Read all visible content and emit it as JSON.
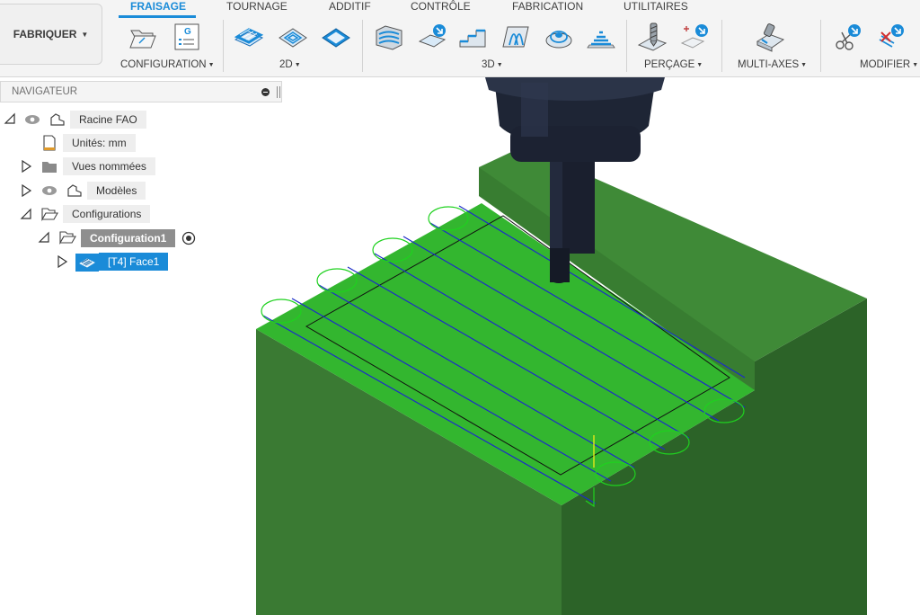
{
  "workspace": {
    "label": "FABRIQUER"
  },
  "tabs": [
    {
      "label": "FRAISAGE",
      "active": true
    },
    {
      "label": "TOURNAGE"
    },
    {
      "label": "ADDITIF"
    },
    {
      "label": "CONTRÔLE"
    },
    {
      "label": "FABRICATION"
    },
    {
      "label": "UTILITAIRES"
    }
  ],
  "groups": {
    "configuration": {
      "label": "CONFIGURATION"
    },
    "g2d": {
      "label": "2D"
    },
    "g3d": {
      "label": "3D"
    },
    "percage": {
      "label": "PERÇAGE"
    },
    "multiaxes": {
      "label": "MULTI-AXES"
    },
    "modifier": {
      "label": "MODIFIER"
    }
  },
  "tools": {
    "new_setup_icon": "folder-open-icon",
    "nc_program_label": "G"
  },
  "navigator": {
    "title": "NAVIGATEUR",
    "items": [
      {
        "label": "Racine FAO"
      },
      {
        "label": "Unités: mm"
      },
      {
        "label": "Vues nommées"
      },
      {
        "label": "Modèles"
      },
      {
        "label": "Configurations"
      },
      {
        "label": "Configuration1"
      },
      {
        "label": "[T4] Face1"
      }
    ]
  },
  "colors": {
    "accent": "#1a8bd8",
    "part_top": "#2fb52f",
    "part_side": "#2f6e2a",
    "part_front": "#3a7a33",
    "toolpath": "#1c2cc8",
    "lead_links": "#1fd11f"
  }
}
